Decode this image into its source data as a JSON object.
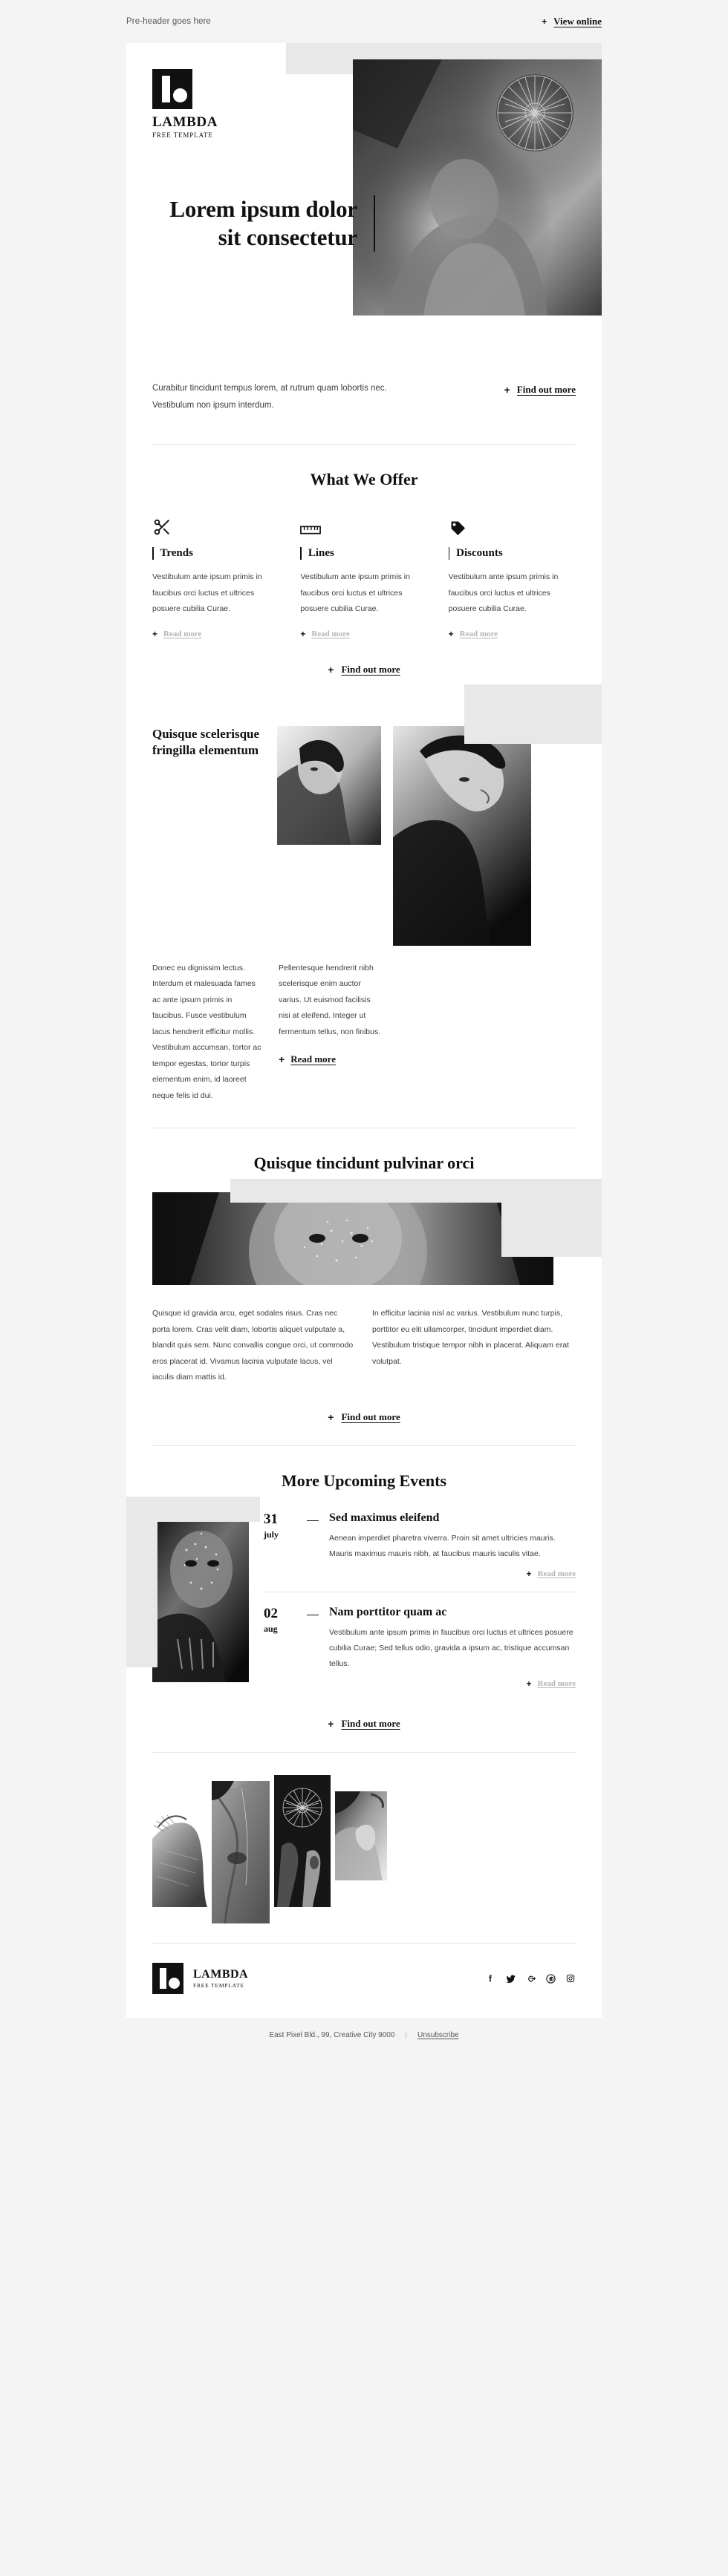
{
  "preheader": {
    "text": "Pre-header goes here",
    "view_online_label": "View online",
    "plus": "+"
  },
  "brand": {
    "name": "LAMBDA",
    "tagline": "FREE TEMPLATE",
    "logo_icon": "lambda-logo-icon"
  },
  "hero": {
    "title": "Lorem ipsum dolor sit consectetur",
    "image_alt": "hero-portrait-image"
  },
  "intro": {
    "paragraph": "Curabitur tincidunt tempus lorem, at rutrum quam lobortis nec. Vestibulum non ipsum interdum.",
    "cta_label": "Find out more"
  },
  "offer": {
    "title": "What We Offer",
    "items": [
      {
        "icon": "scissors-icon",
        "name": "Trends",
        "body": "Vestibulum ante ipsum primis in faucibus orci luctus et ultrices posuere cubilia Curae.",
        "link": "Read more"
      },
      {
        "icon": "ruler-icon",
        "name": "Lines",
        "body": "Vestibulum ante ipsum primis in faucibus orci luctus et ultrices posuere cubilia Curae.",
        "link": "Read more"
      },
      {
        "icon": "price-tag-icon",
        "name": "Discounts",
        "body": "Vestibulum ante ipsum primis in faucibus orci luctus et ultrices posuere cubilia Curae.",
        "link": "Read more"
      }
    ],
    "cta_label": "Find out more"
  },
  "feature": {
    "title": "Quisque scelerisque fringilla elementum",
    "left_text": "Donec eu dignissim lectus. Interdum et malesuada fames ac ante ipsum primis in faucibus. Fusce vestibulum lacus hendrerit efficitur mollis. Vestibulum accumsan, tortor ac tempor egestas, tortor turpis elementum enim, id laoreet neque felis id dui.",
    "right_text": "Pellentesque hendrerit nibh scelerisque enim auctor varius. Ut euismod facilisis nisi at eleifend. Integer ut fermentum tellus, non finibus.",
    "cta_label": "Read more",
    "image_a_alt": "portrait-profile-image",
    "image_b_alt": "portrait-looking-up-image"
  },
  "wide": {
    "title": "Quisque tincidunt pulvinar orci",
    "image_alt": "freckled-face-banner-image",
    "left_text": "Quisque id gravida arcu, eget sodales risus. Cras nec porta lorem. Cras velit diam, lobortis aliquet vulputate a, blandit quis sem. Nunc convallis congue orci, ut commodo eros placerat id. Vivamus lacinia vulputate lacus, vel iaculis diam mattis id.",
    "right_text": "In efficitur lacinia nisl ac varius. Vestibulum nunc turpis, porttitor eu elit ullamcorper, tincidunt imperdiet diam. Vestibulum tristique tempor nibh in placerat. Aliquam erat volutpat.",
    "cta_label": "Find out more"
  },
  "events": {
    "title": "More Upcoming Events",
    "image_alt": "painted-face-event-image",
    "items": [
      {
        "day": "31",
        "month": "july",
        "title": "Sed maximus eleifend",
        "body": "Aenean imperdiet pharetra viverra. Proin sit amet ultricies mauris. Mauris maximus mauris nibh, at faucibus mauris iaculis vitae.",
        "link": "Read more"
      },
      {
        "day": "02",
        "month": "aug",
        "title": "Nam porttitor quam ac",
        "body": "Vestibulum ante ipsum primis in faucibus orci luctus et ultrices posuere cubilia Curae; Sed tellus odio, gravida a ipsum ac, tristique accumsan tellus.",
        "link": "Read more"
      }
    ],
    "cta_label": "Find out more"
  },
  "gallery": {
    "images": [
      "shoulder-texture-image",
      "neck-collarbone-image",
      "woven-disc-image",
      "shoulder-hand-image"
    ]
  },
  "footer": {
    "socials": [
      "facebook-icon",
      "twitter-icon",
      "google-plus-icon",
      "pinterest-icon",
      "instagram-icon"
    ],
    "address": "East Pixel Bld., 99, Creative City 9000",
    "separator": "|",
    "unsubscribe": "Unsubscribe"
  },
  "colors": {
    "page_bg": "#f4f4f4",
    "card_bg": "#ffffff",
    "ink": "#111111",
    "body_text": "#3d3d3d",
    "muted_link": "#b4b4b4",
    "deco": "#e8e8e8",
    "rule": "#e3e3e3"
  }
}
